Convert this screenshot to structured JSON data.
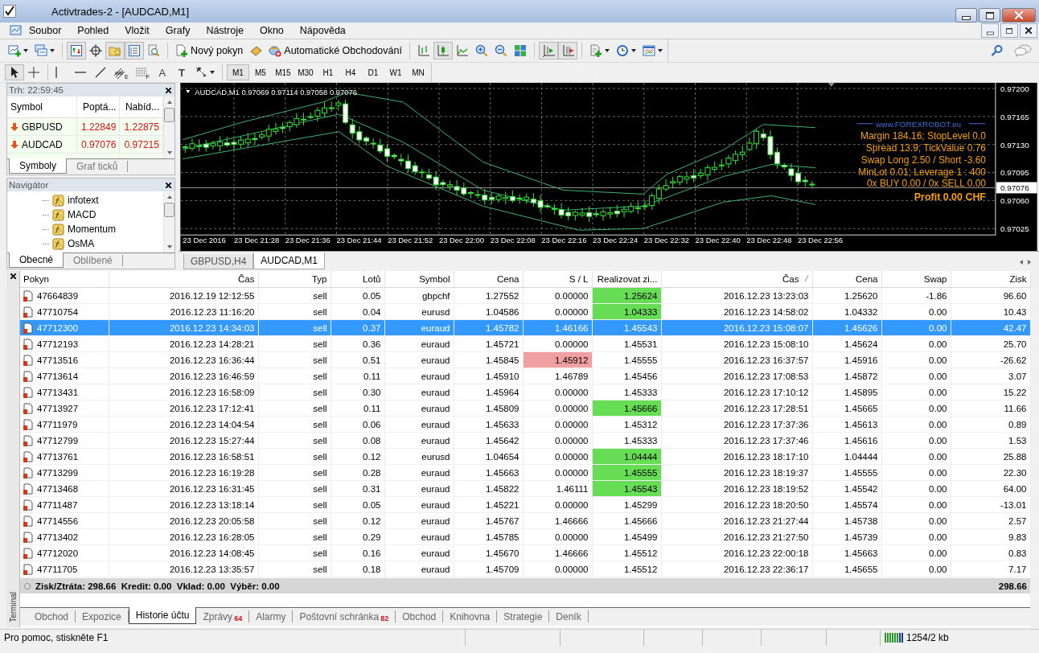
{
  "window": {
    "title": "Activtrades-2 - [AUDCAD,M1]"
  },
  "menu": [
    "Soubor",
    "Pohled",
    "Vložit",
    "Grafy",
    "Nástroje",
    "Okno",
    "Nápověda"
  ],
  "toolbar": [
    {
      "kind": "new-chart",
      "pressed": false
    },
    {
      "kind": "profiles",
      "pressed": false
    },
    {
      "kind": "sep"
    },
    {
      "kind": "market-watch",
      "pressed": true
    },
    {
      "kind": "data-window",
      "pressed": false
    },
    {
      "kind": "navigator",
      "pressed": true
    },
    {
      "kind": "terminal",
      "pressed": true
    },
    {
      "kind": "tester",
      "pressed": false
    },
    {
      "kind": "sep"
    },
    {
      "kind": "new-order",
      "label": "Nový pokyn",
      "pressed": false
    },
    {
      "kind": "editor",
      "pressed": false
    },
    {
      "kind": "auto-trading",
      "label": "Automatické Obchodování",
      "pressed": false
    },
    {
      "kind": "sep"
    },
    {
      "kind": "bar-chart",
      "pressed": false
    },
    {
      "kind": "candles",
      "pressed": true
    },
    {
      "kind": "line-chart",
      "pressed": false
    },
    {
      "kind": "zoom-in",
      "pressed": false
    },
    {
      "kind": "zoom-out",
      "pressed": false
    },
    {
      "kind": "tile",
      "pressed": false
    },
    {
      "kind": "sep"
    },
    {
      "kind": "autoscroll",
      "pressed": true
    },
    {
      "kind": "chart-shift",
      "pressed": true
    },
    {
      "kind": "sep"
    },
    {
      "kind": "indicators",
      "pressed": false
    },
    {
      "kind": "periods",
      "pressed": false
    },
    {
      "kind": "templates",
      "pressed": false
    }
  ],
  "drawing_tools": [
    {
      "kind": "cursor",
      "pressed": true
    },
    {
      "kind": "crosshair",
      "pressed": false
    },
    {
      "kind": "sep"
    },
    {
      "kind": "vline",
      "pressed": false
    },
    {
      "kind": "hline",
      "pressed": false
    },
    {
      "kind": "trendline",
      "pressed": false
    },
    {
      "kind": "fib-channel",
      "label": "E",
      "pressed": false
    },
    {
      "kind": "fibo",
      "label": "F",
      "pressed": false
    },
    {
      "kind": "text",
      "label": "A",
      "pressed": false
    },
    {
      "kind": "text-label",
      "label": "T",
      "pressed": false
    },
    {
      "kind": "arrows",
      "pressed": false
    }
  ],
  "periods": [
    {
      "label": "M1",
      "selected": true
    },
    {
      "label": "M5",
      "selected": false
    },
    {
      "label": "M15",
      "selected": false
    },
    {
      "label": "M30",
      "selected": false
    },
    {
      "label": "H1",
      "selected": false
    },
    {
      "label": "H4",
      "selected": false
    },
    {
      "label": "D1",
      "selected": false
    },
    {
      "label": "W1",
      "selected": false
    },
    {
      "label": "MN",
      "selected": false
    }
  ],
  "market_watch": {
    "title": "Trh: 22:59:45",
    "columns": [
      "Symbol",
      "Poptá...",
      "Nabíd..."
    ],
    "rows": [
      {
        "symbol": "GBPUSD",
        "bid": "1.22849",
        "ask": "1.22875",
        "falling": true
      },
      {
        "symbol": "AUDCAD",
        "bid": "0.97076",
        "ask": "0.97215",
        "falling": true
      }
    ],
    "tabs": [
      {
        "label": "Symboly",
        "selected": true
      },
      {
        "label": "Graf ticků",
        "selected": false
      }
    ]
  },
  "navigator": {
    "title": "Navigátor",
    "items": [
      "infotext",
      "MACD",
      "Momentum",
      "OsMA"
    ],
    "tabs": [
      {
        "label": "Obecné",
        "selected": true
      },
      {
        "label": "Oblíbené",
        "selected": false
      }
    ]
  },
  "chart": {
    "symbol": "AUDCAD,M1",
    "ohlc": "0.97069 0.97114 0.97058 0.97076",
    "price_labels": [
      {
        "label": "0.97200",
        "current": false
      },
      {
        "label": "0.97165",
        "current": false
      },
      {
        "label": "0.97130",
        "current": false
      },
      {
        "label": "0.97095",
        "current": false
      },
      {
        "label": "0.97076",
        "current": true
      },
      {
        "label": "0.97060",
        "current": false
      },
      {
        "label": "0.97025",
        "current": false
      }
    ],
    "time_labels": [
      "23 Dec 2016",
      "23 Dec 21:28",
      "23 Dec 21:36",
      "23 Dec 21:44",
      "23 Dec 21:52",
      "23 Dec 22:00",
      "23 Dec 22:08",
      "23 Dec 22:16",
      "23 Dec 22:24",
      "23 Dec 22:32",
      "23 Dec 22:40",
      "23 Dec 22:48",
      "23 Dec 22:56"
    ],
    "info": [
      {
        "kind": "header",
        "text": "www.FOREXROBOT.eu"
      },
      {
        "kind": "line",
        "text": "Margin 184.16; StopLevel 0.0"
      },
      {
        "kind": "line",
        "text": "Spread 13.9; TickValue 0.76"
      },
      {
        "kind": "line",
        "text": "Swap Long 2.50 / Short -3.60"
      },
      {
        "kind": "line",
        "text": "MinLot 0.01; Leverage 1 : 400"
      },
      {
        "kind": "line",
        "text": "0x BUY 0.00 / 0x SELL 0.00"
      },
      {
        "kind": "profit",
        "text": "Profit 0.00 CHF"
      }
    ]
  },
  "chart_tabs": [
    {
      "label": "GBPUSD,H4",
      "selected": false
    },
    {
      "label": "AUDCAD,M1",
      "selected": true
    }
  ],
  "terminal": {
    "title": "Terminal",
    "columns": [
      {
        "label": "Pokyn",
        "sorted": false
      },
      {
        "label": "Čas",
        "sorted": false
      },
      {
        "label": "Typ",
        "sorted": false
      },
      {
        "label": "Lotů",
        "sorted": false
      },
      {
        "label": "Symbol",
        "sorted": false
      },
      {
        "label": "Cena",
        "sorted": false
      },
      {
        "label": "S / L",
        "sorted": false
      },
      {
        "label": "Realizovat zi...",
        "sorted": false
      },
      {
        "label": "Čas",
        "sorted": true
      },
      {
        "label": "Cena",
        "sorted": false
      },
      {
        "label": "Swap",
        "sorted": false
      },
      {
        "label": "Zisk",
        "sorted": false
      }
    ],
    "rows": [
      {
        "order": "47664839",
        "open_time": "2016.12.19 12:12:55",
        "type": "sell",
        "lots": "0.05",
        "symbol": "gbpchf",
        "open_price": "1.27552",
        "sl": "0.00000",
        "tp": "1.25624",
        "close_time": "2016.12.23 13:23:03",
        "close_price": "1.25620",
        "swap": "-1.86",
        "profit": "96.60",
        "selected": false,
        "sl_hit": false,
        "tp_hit": true
      },
      {
        "order": "47710754",
        "open_time": "2016.12.23 11:16:20",
        "type": "sell",
        "lots": "0.04",
        "symbol": "eurusd",
        "open_price": "1.04586",
        "sl": "0.00000",
        "tp": "1.04333",
        "close_time": "2016.12.23 14:58:02",
        "close_price": "1.04332",
        "swap": "0.00",
        "profit": "10.43",
        "selected": false,
        "sl_hit": false,
        "tp_hit": true
      },
      {
        "order": "47712300",
        "open_time": "2016.12.23 14:34:03",
        "type": "sell",
        "lots": "0.37",
        "symbol": "euraud",
        "open_price": "1.45782",
        "sl": "1.46166",
        "tp": "1.45543",
        "close_time": "2016.12.23 15:08:07",
        "close_price": "1.45626",
        "swap": "0.00",
        "profit": "42.47",
        "selected": true,
        "sl_hit": false,
        "tp_hit": false
      },
      {
        "order": "47712193",
        "open_time": "2016.12.23 14:28:21",
        "type": "sell",
        "lots": "0.36",
        "symbol": "euraud",
        "open_price": "1.45721",
        "sl": "0.00000",
        "tp": "1.45531",
        "close_time": "2016.12.23 15:08:10",
        "close_price": "1.45624",
        "swap": "0.00",
        "profit": "25.70",
        "selected": false,
        "sl_hit": false,
        "tp_hit": false
      },
      {
        "order": "47713516",
        "open_time": "2016.12.23 16:36:44",
        "type": "sell",
        "lots": "0.51",
        "symbol": "euraud",
        "open_price": "1.45845",
        "sl": "1.45912",
        "tp": "1.45555",
        "close_time": "2016.12.23 16:37:57",
        "close_price": "1.45916",
        "swap": "0.00",
        "profit": "-26.62",
        "selected": false,
        "sl_hit": true,
        "tp_hit": false
      },
      {
        "order": "47713614",
        "open_time": "2016.12.23 16:46:59",
        "type": "sell",
        "lots": "0.11",
        "symbol": "euraud",
        "open_price": "1.45910",
        "sl": "1.46789",
        "tp": "1.45456",
        "close_time": "2016.12.23 17:08:53",
        "close_price": "1.45872",
        "swap": "0.00",
        "profit": "3.07",
        "selected": false,
        "sl_hit": false,
        "tp_hit": false
      },
      {
        "order": "47713431",
        "open_time": "2016.12.23 16:58:09",
        "type": "sell",
        "lots": "0.30",
        "symbol": "euraud",
        "open_price": "1.45964",
        "sl": "0.00000",
        "tp": "1.45333",
        "close_time": "2016.12.23 17:10:12",
        "close_price": "1.45895",
        "swap": "0.00",
        "profit": "15.22",
        "selected": false,
        "sl_hit": false,
        "tp_hit": false
      },
      {
        "order": "47713927",
        "open_time": "2016.12.23 17:12:41",
        "type": "sell",
        "lots": "0.11",
        "symbol": "euraud",
        "open_price": "1.45809",
        "sl": "0.00000",
        "tp": "1.45666",
        "close_time": "2016.12.23 17:28:51",
        "close_price": "1.45665",
        "swap": "0.00",
        "profit": "11.66",
        "selected": false,
        "sl_hit": false,
        "tp_hit": true
      },
      {
        "order": "47711979",
        "open_time": "2016.12.23 14:04:54",
        "type": "sell",
        "lots": "0.06",
        "symbol": "euraud",
        "open_price": "1.45633",
        "sl": "0.00000",
        "tp": "1.45312",
        "close_time": "2016.12.23 17:37:36",
        "close_price": "1.45613",
        "swap": "0.00",
        "profit": "0.89",
        "selected": false,
        "sl_hit": false,
        "tp_hit": false
      },
      {
        "order": "47712799",
        "open_time": "2016.12.23 15:27:44",
        "type": "sell",
        "lots": "0.08",
        "symbol": "euraud",
        "open_price": "1.45642",
        "sl": "0.00000",
        "tp": "1.45333",
        "close_time": "2016.12.23 17:37:46",
        "close_price": "1.45616",
        "swap": "0.00",
        "profit": "1.53",
        "selected": false,
        "sl_hit": false,
        "tp_hit": false
      },
      {
        "order": "47713761",
        "open_time": "2016.12.23 16:58:51",
        "type": "sell",
        "lots": "0.12",
        "symbol": "eurusd",
        "open_price": "1.04654",
        "sl": "0.00000",
        "tp": "1.04444",
        "close_time": "2016.12.23 18:17:10",
        "close_price": "1.04444",
        "swap": "0.00",
        "profit": "25.88",
        "selected": false,
        "sl_hit": false,
        "tp_hit": true
      },
      {
        "order": "47713299",
        "open_time": "2016.12.23 16:19:28",
        "type": "sell",
        "lots": "0.28",
        "symbol": "euraud",
        "open_price": "1.45663",
        "sl": "0.00000",
        "tp": "1.45555",
        "close_time": "2016.12.23 18:19:37",
        "close_price": "1.45555",
        "swap": "0.00",
        "profit": "22.30",
        "selected": false,
        "sl_hit": false,
        "tp_hit": true
      },
      {
        "order": "47713468",
        "open_time": "2016.12.23 16:31:45",
        "type": "sell",
        "lots": "0.31",
        "symbol": "euraud",
        "open_price": "1.45822",
        "sl": "1.46111",
        "tp": "1.45543",
        "close_time": "2016.12.23 18:19:52",
        "close_price": "1.45542",
        "swap": "0.00",
        "profit": "64.00",
        "selected": false,
        "sl_hit": false,
        "tp_hit": true
      },
      {
        "order": "47711487",
        "open_time": "2016.12.23 13:18:14",
        "type": "sell",
        "lots": "0.05",
        "symbol": "euraud",
        "open_price": "1.45221",
        "sl": "0.00000",
        "tp": "1.45299",
        "close_time": "2016.12.23 18:20:50",
        "close_price": "1.45574",
        "swap": "0.00",
        "profit": "-13.01",
        "selected": false,
        "sl_hit": false,
        "tp_hit": false
      },
      {
        "order": "47714556",
        "open_time": "2016.12.23 20:05:58",
        "type": "sell",
        "lots": "0.12",
        "symbol": "euraud",
        "open_price": "1.45767",
        "sl": "1.46666",
        "tp": "1.45666",
        "close_time": "2016.12.23 21:27:44",
        "close_price": "1.45738",
        "swap": "0.00",
        "profit": "2.57",
        "selected": false,
        "sl_hit": false,
        "tp_hit": false
      },
      {
        "order": "47713402",
        "open_time": "2016.12.23 16:28:05",
        "type": "sell",
        "lots": "0.29",
        "symbol": "euraud",
        "open_price": "1.45785",
        "sl": "0.00000",
        "tp": "1.45499",
        "close_time": "2016.12.23 21:27:50",
        "close_price": "1.45739",
        "swap": "0.00",
        "profit": "9.83",
        "selected": false,
        "sl_hit": false,
        "tp_hit": false
      },
      {
        "order": "47712020",
        "open_time": "2016.12.23 14:08:45",
        "type": "sell",
        "lots": "0.16",
        "symbol": "euraud",
        "open_price": "1.45670",
        "sl": "1.46666",
        "tp": "1.45512",
        "close_time": "2016.12.23 22:00:18",
        "close_price": "1.45663",
        "swap": "0.00",
        "profit": "0.83",
        "selected": false,
        "sl_hit": false,
        "tp_hit": false
      },
      {
        "order": "47711705",
        "open_time": "2016.12.23 13:35:57",
        "type": "sell",
        "lots": "0.18",
        "symbol": "euraud",
        "open_price": "1.45709",
        "sl": "0.00000",
        "tp": "1.45512",
        "close_time": "2016.12.23 22:36:17",
        "close_price": "1.45655",
        "swap": "0.00",
        "profit": "7.17",
        "selected": false,
        "sl_hit": false,
        "tp_hit": false
      }
    ],
    "summary": {
      "text": "Zisk/Ztráta: 298.66  Kredit: 0.00  Vklad: 0.00  Výběr: 0.00",
      "total": "298.66"
    },
    "tabs": [
      {
        "label": "Obchod",
        "selected": false
      },
      {
        "label": "Expozice",
        "selected": false
      },
      {
        "label": "Historie účtu",
        "selected": true
      },
      {
        "label": "Zprávy",
        "badge": "64",
        "selected": false
      },
      {
        "label": "Alarmy",
        "selected": false
      },
      {
        "label": "Poštovní schránka",
        "badge": "82",
        "selected": false
      },
      {
        "label": "Obchod",
        "selected": false
      },
      {
        "label": "Knihovna",
        "selected": false
      },
      {
        "label": "Strategie",
        "selected": false
      },
      {
        "label": "Deník",
        "selected": false
      }
    ]
  },
  "status_bar": {
    "help": "Pro pomoc, stiskněte F1",
    "traffic": "1254/2 kb"
  }
}
